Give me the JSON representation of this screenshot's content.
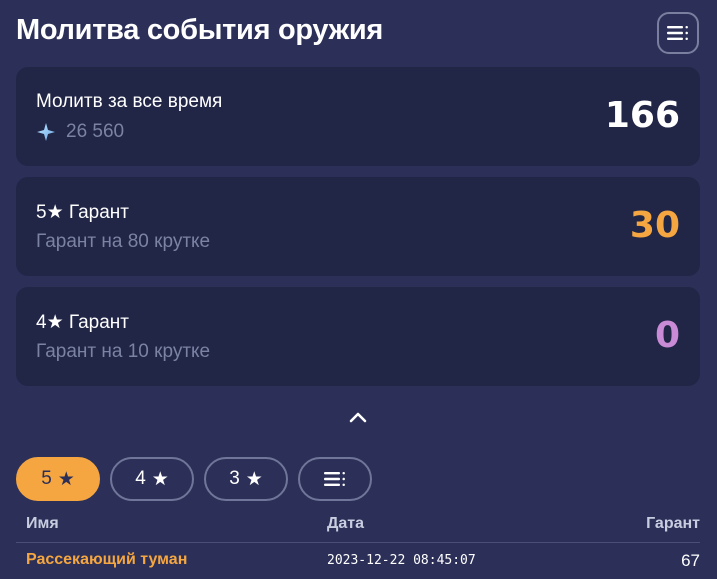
{
  "header": {
    "title": "Молитва события оружия",
    "menu_icon": "list-filter-icon"
  },
  "cards": [
    {
      "label": "Молитв за все время",
      "sub_icon": "primogem-icon",
      "sub_text": "26 560",
      "value": "166",
      "value_color": "#ffffff"
    },
    {
      "label": "5★ Гарант",
      "sub_text": "Гарант на 80 крутке",
      "value": "30",
      "value_color": "#f5a640"
    },
    {
      "label": "4★ Гарант",
      "sub_text": "Гарант на 10 крутке",
      "value": "0",
      "value_color": "#c98ad6"
    }
  ],
  "collapse_icon": "chevron-up-icon",
  "filters": [
    {
      "label": "5",
      "star": "★",
      "active": true
    },
    {
      "label": "4",
      "star": "★",
      "active": false
    },
    {
      "label": "3",
      "star": "★",
      "active": false
    }
  ],
  "filter_menu_icon": "list-filter-icon",
  "table": {
    "headers": {
      "name": "Имя",
      "date": "Дата",
      "pity": "Гарант"
    },
    "rows": [
      {
        "name": "Рассекающий туман",
        "date": "2023-12-22 08:45:07",
        "pity": "67"
      }
    ]
  },
  "colors": {
    "background": "#2c3058",
    "card": "#212546",
    "accent_gold": "#f5a640",
    "accent_purple": "#c98ad6",
    "muted": "#7b83a3"
  }
}
